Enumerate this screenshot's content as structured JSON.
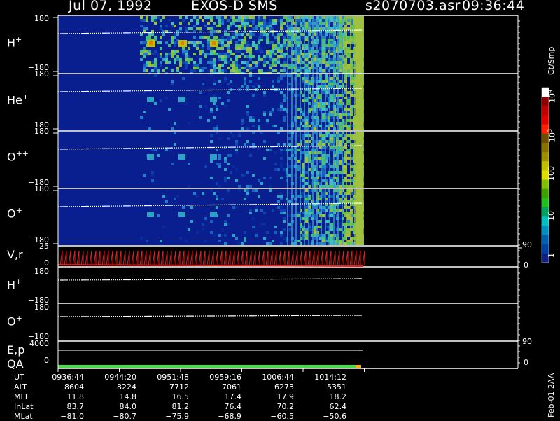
{
  "header": {
    "date": "Jul 07, 1992",
    "instrument": "EXOS-D SMS",
    "file": "s2070703.asr",
    "time": "09:36:44"
  },
  "panels": [
    {
      "name": "H",
      "sup": "+",
      "top": "180",
      "bottom": "−180"
    },
    {
      "name": "He",
      "sup": "+",
      "top": "180",
      "bottom": "−180"
    },
    {
      "name": "O",
      "sup": "++",
      "top": "180",
      "bottom": "−180"
    },
    {
      "name": "O",
      "sup": "+",
      "top": "180",
      "bottom": "−180"
    }
  ],
  "vr_panel": {
    "label": "V,r",
    "left_top": "25",
    "left_bottom": "0",
    "right_top": "90",
    "right_bottom": "0"
  },
  "lower_panels": [
    {
      "name": "H",
      "sup": "+",
      "top": "180",
      "bottom": "−180"
    },
    {
      "name": "O",
      "sup": "+",
      "top": "180",
      "bottom": "−180"
    }
  ],
  "ep_panel": {
    "label": "E,p",
    "left_top": "4000",
    "right_top": "90"
  },
  "qa_panel": {
    "label": "QA",
    "left_bottom": "0",
    "right_bottom": "0"
  },
  "colorbar": {
    "unit": "Ct/Smp",
    "ticks": [
      "10",
      "10",
      "10",
      "100",
      "10",
      "1"
    ],
    "tick_sups": [
      "4",
      "3",
      "",
      "",
      "",
      ""
    ],
    "colors": [
      "#ffffff",
      "#8b0000",
      "#c00000",
      "#e00000",
      "#ff2000",
      "#6b4e00",
      "#8a7000",
      "#a09000",
      "#c0c000",
      "#e0e000",
      "#80c000",
      "#40a000",
      "#20c020",
      "#00a060",
      "#00c0c0",
      "#0090c0",
      "#0060b0",
      "#0040a0",
      "#102080"
    ]
  },
  "footer_code": "Feb-01 2AA",
  "orbit_table": {
    "row_labels": [
      "UT",
      "ALT",
      "MLT",
      "InLat",
      "MLat"
    ],
    "columns": [
      [
        "0936:44",
        "8604",
        "11.8",
        "83.7",
        "−81.0"
      ],
      [
        "0944:20",
        "8224",
        "14.8",
        "84.0",
        "−80.7"
      ],
      [
        "0951:48",
        "7712",
        "16.5",
        "81.2",
        "−75.9"
      ],
      [
        "0959:16",
        "7061",
        "17.4",
        "76.4",
        "−68.9"
      ],
      [
        "1006:44",
        "6273",
        "17.9",
        "70.2",
        "−60.5"
      ],
      [
        "1014:12",
        "5351",
        "18.2",
        "62.4",
        "−50.6"
      ]
    ]
  },
  "chart_data": {
    "type": "heatmap",
    "title": "Jul 07, 1992 EXOS-D SMS",
    "x_tick_labels": [
      "0936:44",
      "0944:20",
      "0951:48",
      "0959:16",
      "1006:44",
      "1014:12"
    ],
    "ion_panels": [
      "H+",
      "He+",
      "O++",
      "O+"
    ],
    "ylim": [
      -180,
      180
    ],
    "colorbar_unit": "Ct/Smp",
    "colorbar_range": [
      1,
      10000
    ]
  }
}
